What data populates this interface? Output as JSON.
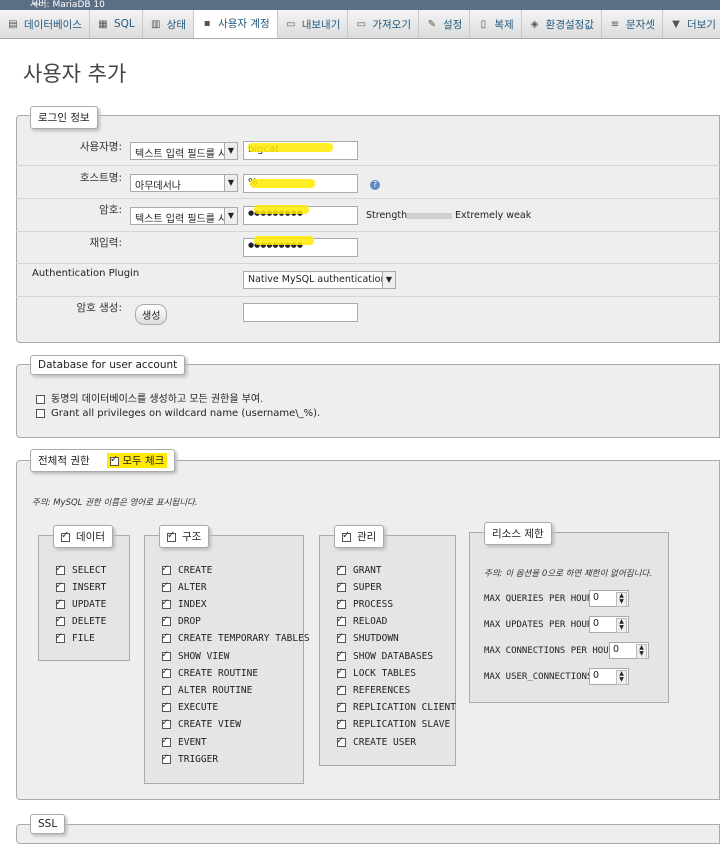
{
  "window": {
    "title": "서버: MariaDB 10"
  },
  "tabs": [
    {
      "label": "데이터베이스",
      "icon": "database-icon"
    },
    {
      "label": "SQL",
      "icon": "sql-icon"
    },
    {
      "label": "상태",
      "icon": "status-icon"
    },
    {
      "label": "사용자 계정",
      "icon": "users-icon"
    },
    {
      "label": "내보내기",
      "icon": "export-icon"
    },
    {
      "label": "가져오기",
      "icon": "import-icon"
    },
    {
      "label": "설정",
      "icon": "wrench-icon"
    },
    {
      "label": "복제",
      "icon": "replication-icon"
    },
    {
      "label": "환경설정값",
      "icon": "variables-icon"
    },
    {
      "label": "문자셋",
      "icon": "charset-icon"
    },
    {
      "label": "더보기",
      "icon": "chevron-down-icon"
    }
  ],
  "page_title": "사용자 추가",
  "login": {
    "legend": "로그인 정보",
    "username_label": "사용자명:",
    "username_select": "텍스트 입력 필드를 사",
    "username_value": "bigcat",
    "host_label": "호스트명:",
    "host_select": "아무데서나",
    "host_value": "%",
    "password_label": "암호:",
    "password_select": "텍스트 입력 필드를 사",
    "password_value": "●●●●●●●●●",
    "strength_label": "Strength:",
    "strength_value": "Extremely weak",
    "retype_label": "재입력:",
    "retype_value": "●●●●●●●●●",
    "auth_label": "Authentication Plugin",
    "auth_value": "Native MySQL authentication",
    "generate_label": "암호 생성:",
    "generate_button": "생성",
    "generate_value": ""
  },
  "database": {
    "legend": "Database for user account",
    "option1": "동명의 데이터베이스를 생성하고 모든 권한을 부여.",
    "option2": "Grant all privileges on wildcard name (username\\_%)."
  },
  "global": {
    "legend": "전체적 권한",
    "check_all": "모두 체크",
    "note": "주의: MySQL 권한 이름은 영어로 표시됩니다.",
    "data": {
      "label": "데이터",
      "items": [
        "SELECT",
        "INSERT",
        "UPDATE",
        "DELETE",
        "FILE"
      ]
    },
    "structure": {
      "label": "구조",
      "items": [
        "CREATE",
        "ALTER",
        "INDEX",
        "DROP",
        "CREATE TEMPORARY TABLES",
        "SHOW VIEW",
        "CREATE ROUTINE",
        "ALTER ROUTINE",
        "EXECUTE",
        "CREATE VIEW",
        "EVENT",
        "TRIGGER"
      ]
    },
    "admin": {
      "label": "관리",
      "items": [
        "GRANT",
        "SUPER",
        "PROCESS",
        "RELOAD",
        "SHUTDOWN",
        "SHOW DATABASES",
        "LOCK TABLES",
        "REFERENCES",
        "REPLICATION CLIENT",
        "REPLICATION SLAVE",
        "CREATE USER"
      ]
    },
    "resources": {
      "label": "리소스 제한",
      "note": "주의: 이 옵션을 0으로 하면 제한이 없어집니다.",
      "items": [
        {
          "label": "MAX QUERIES PER HOUR",
          "value": "0"
        },
        {
          "label": "MAX UPDATES PER HOUR",
          "value": "0"
        },
        {
          "label": "MAX CONNECTIONS PER HOUR",
          "value": "0"
        },
        {
          "label": "MAX USER_CONNECTIONS",
          "value": "0"
        }
      ]
    }
  },
  "ssl": {
    "legend": "SSL"
  }
}
